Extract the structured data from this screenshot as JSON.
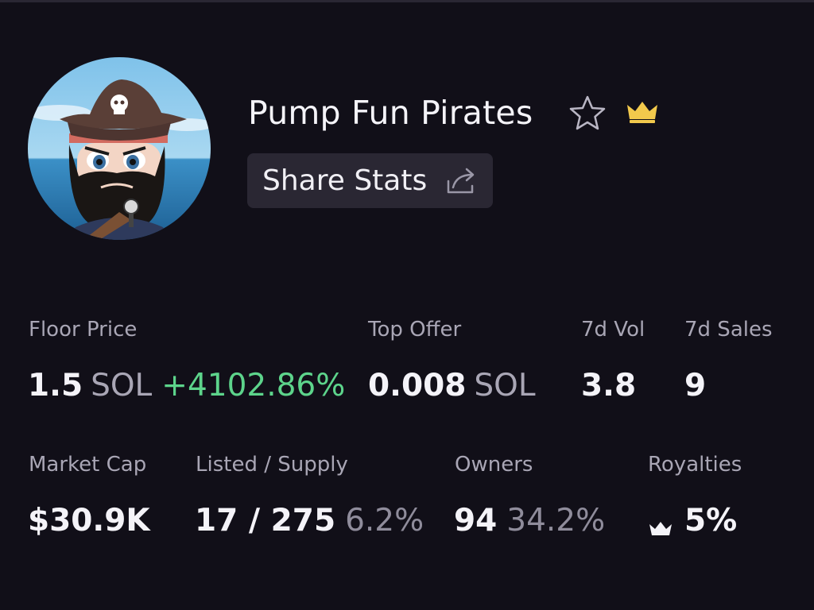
{
  "collection": {
    "name": "Pump Fun Pirates",
    "avatar_icon": "pirate-avatar",
    "favorite_icon": "star-outline-icon",
    "badge_icon": "crown-icon",
    "badge_color": "#f2c94c"
  },
  "share": {
    "label": "Share Stats",
    "icon": "share-icon"
  },
  "stats": {
    "floor_price": {
      "label": "Floor Price",
      "value": "1.5",
      "unit": "SOL",
      "change": "+4102.86%"
    },
    "top_offer": {
      "label": "Top Offer",
      "value": "0.008",
      "unit": "SOL"
    },
    "vol_7d": {
      "label": "7d Vol",
      "value": "3.8"
    },
    "sales_7d": {
      "label": "7d Sales",
      "value": "9"
    },
    "market_cap": {
      "label": "Market Cap",
      "value": "$30.9K"
    },
    "listed_supply": {
      "label": "Listed / Supply",
      "value": "17 / 275",
      "pct": "6.2%"
    },
    "owners": {
      "label": "Owners",
      "value": "94",
      "pct": "34.2%"
    },
    "royalties": {
      "label": "Royalties",
      "value": "5%",
      "icon": "crown-icon"
    }
  },
  "colors": {
    "background": "#110f18",
    "positive": "#5dd48b",
    "button_bg": "#2a2733",
    "muted_text": "#a9a6b5"
  }
}
